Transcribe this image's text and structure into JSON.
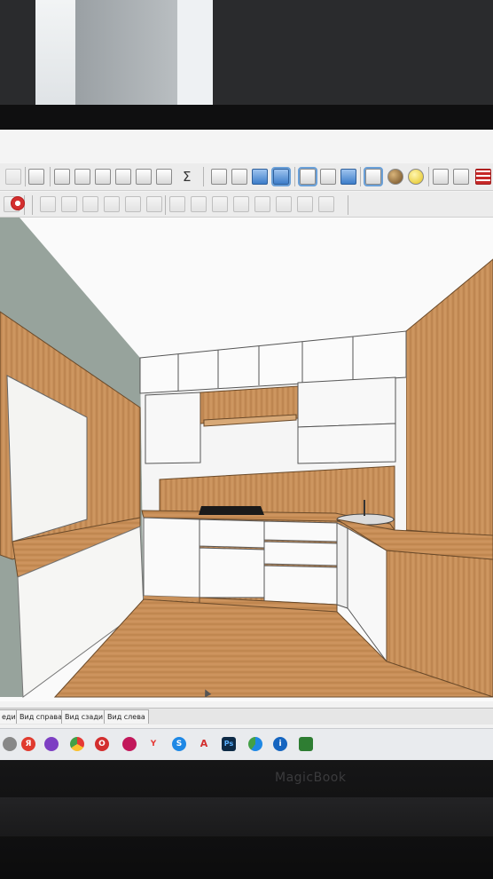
{
  "toolbar": {
    "sum_glyph": "Σ"
  },
  "scene_tabs": [
    {
      "label": "еди"
    },
    {
      "label": "Вид справа"
    },
    {
      "label": "Вид сзади"
    },
    {
      "label": "Вид слева"
    }
  ],
  "taskbar": {
    "apps": [
      {
        "name": "yandex-browser",
        "glyph": "Я",
        "color": "#e03b2f"
      },
      {
        "name": "feather-app",
        "glyph": "",
        "color": "#7d3fc3"
      },
      {
        "name": "chrome",
        "glyph": "",
        "color": "#4caf50"
      },
      {
        "name": "opera",
        "glyph": "O",
        "color": "#d32f2f"
      },
      {
        "name": "heart-app",
        "glyph": "",
        "color": "#c2185b"
      },
      {
        "name": "yandex",
        "glyph": "Y",
        "color": "#e53935"
      },
      {
        "name": "skype",
        "glyph": "S",
        "color": "#1e88e5"
      },
      {
        "name": "acrobat",
        "glyph": "A",
        "color": "#d32f2f"
      },
      {
        "name": "photoshop",
        "glyph": "Ps",
        "color": "#0d2a46"
      },
      {
        "name": "edge",
        "glyph": "",
        "color": "#1e88e5"
      },
      {
        "name": "info-app",
        "glyph": "i",
        "color": "#1565c0"
      },
      {
        "name": "sketchup",
        "glyph": "",
        "color": "#2e7d32"
      }
    ]
  },
  "laptop": {
    "brand": "MagicBook"
  }
}
